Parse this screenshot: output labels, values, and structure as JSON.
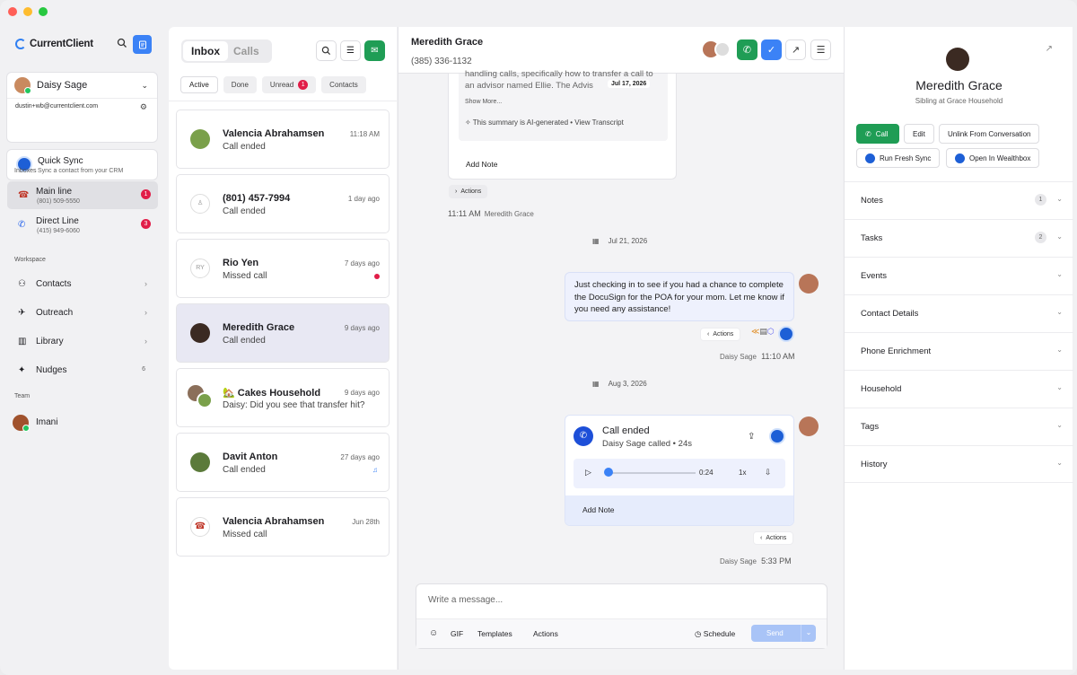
{
  "sidebar": {
    "brand": "CurrentClient",
    "account": {
      "name": "Daisy Sage",
      "email": "dustin+wb@currentclient.com"
    },
    "quick_sync": {
      "title": "Quick Sync",
      "subtitle": "Sync a contact from your CRM"
    },
    "inboxes_label": "Inboxes",
    "inboxes": [
      {
        "label": "Main line",
        "number": "(801) 509-5550",
        "badge": "1",
        "icon": "phone-icon"
      },
      {
        "label": "Direct Line",
        "number": "(415) 949-6060",
        "badge": "3",
        "icon": "handset-icon"
      }
    ],
    "workspace_label": "Workspace",
    "workspace": [
      {
        "label": "Contacts",
        "icon": "person-icon"
      },
      {
        "label": "Outreach",
        "icon": "megaphone-icon"
      },
      {
        "label": "Library",
        "icon": "books-icon"
      },
      {
        "label": "Nudges",
        "icon": "sparkle-icon",
        "count": "6"
      }
    ],
    "team_label": "Team",
    "team": [
      {
        "label": "Imani"
      }
    ]
  },
  "inbox": {
    "tab_inbox": "Inbox",
    "tab_calls": "Calls",
    "filters": {
      "active": "Active",
      "done": "Done",
      "unread": "Unread",
      "unread_count": "1",
      "contacts": "Contacts"
    },
    "conversations": [
      {
        "name": "Valencia Abrahamsen",
        "preview": "Call ended",
        "time": "11:18 AM"
      },
      {
        "name": "(801) 457-7994",
        "preview": "Call ended",
        "time": "1 day ago"
      },
      {
        "name": "Rio Yen",
        "preview": "Missed call",
        "time": "7 days ago",
        "initials": "RY"
      },
      {
        "name": "Meredith Grace",
        "preview": "Call ended",
        "time": "9 days ago"
      },
      {
        "name": "🏡 Cakes Household",
        "preview": "Daisy: Did you see that transfer hit?",
        "time": "9 days ago"
      },
      {
        "name": "Davit Anton",
        "preview": "Call ended",
        "time": "27 days ago"
      },
      {
        "name": "Valencia Abrahamsen",
        "preview": "Missed call",
        "time": "Jun 28th"
      }
    ]
  },
  "chat": {
    "contact_name": "Meredith Grace",
    "contact_phone": "(385) 336-1132",
    "summary": {
      "text": "handling calls, specifically how to transfer a call to an advisor named Ellie. The Advis",
      "date": "Jul 17, 2026",
      "show_more": "Show More...",
      "ai_note": "This summary is AI-generated",
      "view_transcript": "View Transcript",
      "add_note": "Add Note"
    },
    "actions_label": "Actions",
    "first_meta": {
      "time": "11:11 AM",
      "name": "Meredith Grace"
    },
    "date1": "Jul 21, 2026",
    "message": "Just checking in to see if you had a chance to complete the DocuSign for the POA for your mom. Let me know if you need any assistance!",
    "message_meta": {
      "name": "Daisy Sage",
      "time": "11:10 AM"
    },
    "date2": "Aug 3, 2026",
    "call": {
      "title": "Call ended",
      "subtitle": "Daisy Sage called",
      "duration": "24s",
      "elapsed": "0:24",
      "speed": "1x",
      "add_note": "Add Note",
      "progress": 0.0
    },
    "call_meta": {
      "name": "Daisy Sage",
      "time": "5:33 PM"
    },
    "composer": {
      "placeholder": "Write a message...",
      "gif": "GIF",
      "templates": "Templates",
      "actions": "Actions",
      "schedule": "Schedule",
      "send": "Send"
    }
  },
  "contact_pane": {
    "name": "Meredith Grace",
    "relation": "Sibling at Grace Household",
    "buttons": {
      "call": "Call",
      "edit": "Edit",
      "unlink": "Unlink From Conversation",
      "fresh_sync": "Run Fresh Sync",
      "wealthbox": "Open In Wealthbox"
    },
    "sections": [
      {
        "title": "Notes",
        "count": "1"
      },
      {
        "title": "Tasks",
        "count": "2"
      },
      {
        "title": "Events"
      },
      {
        "title": "Contact Details"
      },
      {
        "title": "Phone Enrichment"
      },
      {
        "title": "Household"
      },
      {
        "title": "Tags"
      },
      {
        "title": "History"
      }
    ]
  },
  "colors": {
    "accent": "#3b82f6",
    "call_green": "#1f9d55",
    "badge_red": "#e11d48"
  }
}
